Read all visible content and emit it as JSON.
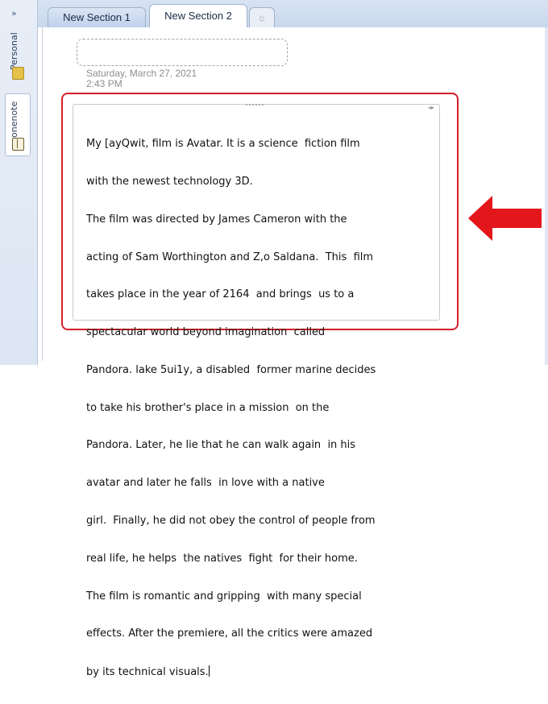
{
  "notebooks": {
    "collapse_glyph": "»",
    "items": [
      {
        "label": "Personal",
        "icon": "notebook-yellow-icon"
      },
      {
        "label": "onenote",
        "icon": "notebook-book-icon"
      }
    ]
  },
  "section_tabs": [
    {
      "label": "New Section 1",
      "active": false
    },
    {
      "label": "New Section 2",
      "active": true
    },
    {
      "label": "☼",
      "icon": "new-section-icon"
    }
  ],
  "page": {
    "title": "",
    "date": "Saturday, March 27, 2021",
    "time": "2:43 PM"
  },
  "note": {
    "lines": [
      "My [ayQwit, film is Avatar. It is a science  fiction film",
      "with the newest technology 3D.",
      "The film was directed by James Cameron with the",
      "acting of Sam Worthington and Z,o Saldana.  This  film",
      "takes place in the year of 2164  and brings  us to a",
      "spectacular world beyond imagination  called",
      "Pandora. lake 5ui1y, a disabled  former marine decides",
      "to take his brother's place in a mission  on the",
      "Pandora. Later, he lie that he can walk again  in his",
      "avatar and later he falls  in love with a native",
      "girl.  Finally, he did not obey the control of people from",
      "real life, he helps  the natives  fight  for their home.",
      "The film is romantic and gripping  with many special",
      "effects. After the premiere, all the critics were amazed",
      "by its technical visuals."
    ]
  },
  "annotation": {
    "highlight_color": "#d42027",
    "arrow_color": "#e3161b"
  }
}
